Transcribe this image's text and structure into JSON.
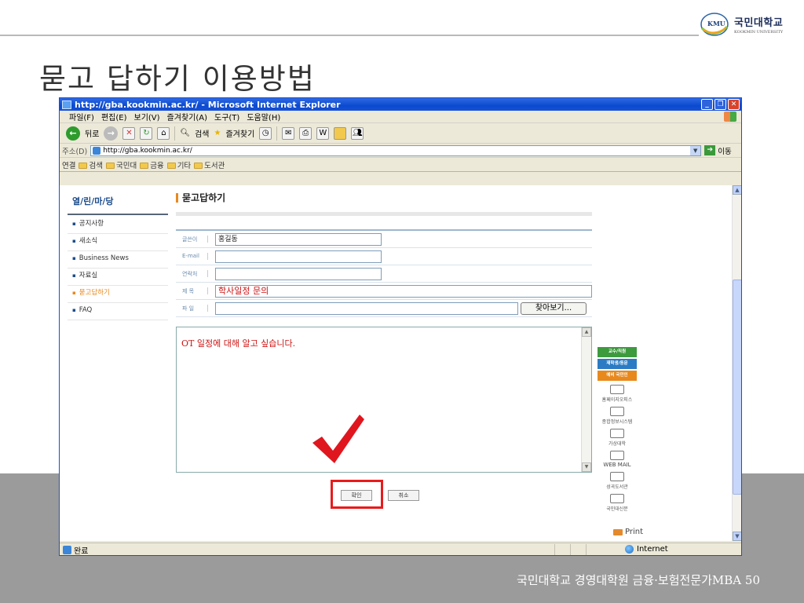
{
  "slide": {
    "title": "묻고 답하기 이용방법",
    "footer": "국민대학교 경영대학원 금융·보험전문가MBA 50",
    "logo_badge": "KMU",
    "logo_name": "국민대학교",
    "logo_sub": "KOOKMIN UNIVERSITY"
  },
  "window": {
    "title": "http://gba.kookmin.ac.kr/ - Microsoft Internet Explorer",
    "menu": [
      "파일(F)",
      "편집(E)",
      "보기(V)",
      "즐겨찾기(A)",
      "도구(T)",
      "도움말(H)"
    ],
    "toolbar": {
      "back": "뒤로",
      "search": "검색",
      "favorites": "즐겨찾기"
    },
    "address_label": "주소(D)",
    "address_value": "http://gba.kookmin.ac.kr/",
    "go_label": "이동",
    "links_label": "연결",
    "links": [
      "검색",
      "국민대",
      "금융",
      "기타",
      "도서관"
    ],
    "status": "완료",
    "zone": "Internet"
  },
  "page": {
    "nav_title": "열/린/마/당",
    "nav_items": [
      "공지사항",
      "새소식",
      "Business News",
      "자료실",
      "묻고답하기",
      "FAQ"
    ],
    "nav_active_index": 4,
    "heading": "묻고답하기",
    "form": {
      "author_label": "글쓴이",
      "author_value": "홍길동",
      "email_label": "E-mail",
      "email_value": "",
      "contact_label": "연락처",
      "contact_value": "",
      "subject_label": "제 목",
      "subject_value": "학사일정 문의",
      "file_label": "파 일",
      "file_value": "",
      "browse_label": "찾아보기...",
      "body": "OT 일정에 대해 알고 싶습니다.",
      "confirm_label": "확인",
      "cancel_label": "취소"
    },
    "quick_links": [
      {
        "label": "교수/직원",
        "color": "#3d9a3d"
      },
      {
        "label": "재학생/동문",
        "color": "#2b7bc4"
      },
      {
        "label": "예비 국민인",
        "color": "#e8891e"
      }
    ],
    "quick_icons": [
      "홈페이지오피스",
      "종합정보시스템",
      "가상대학",
      "WEB MAIL",
      "성곡도서관",
      "국민대신문"
    ],
    "print_label": "Print"
  }
}
